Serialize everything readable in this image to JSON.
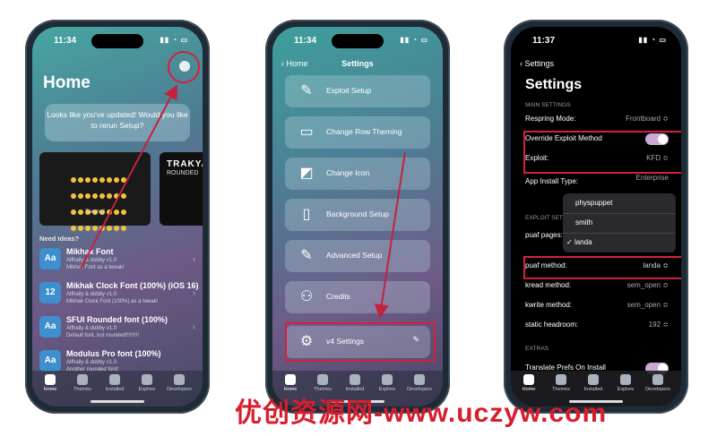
{
  "phones": [
    {
      "time": "11:34",
      "title": "Home",
      "update_prompt": "Looks like you've updated! Would you like to rerun Setup?",
      "cards": [
        {
          "label": "Twemoji"
        },
        {
          "title": "TRAKYA",
          "subtitle": "ROUNDED"
        }
      ],
      "section": "Need Ideas?",
      "items": [
        {
          "icon": "Aa",
          "title": "Mikhak Font",
          "author": "Alfhaily & dobby v1.0",
          "desc": "Mikhak Font as a tweak!"
        },
        {
          "icon": "12",
          "title": "Mikhak Clock Font (100%) (iOS 16)",
          "author": "Alfhaily & dobby v1.0",
          "desc": "Mikhak Clock Font (100%) as a tweak!"
        },
        {
          "icon": "Aa",
          "title": "SFUI Rounded font (100%)",
          "author": "Alfhaily & dobby v1.0",
          "desc": "Default font, but rounded!!!!!!!!!"
        },
        {
          "icon": "Aa",
          "title": "Modulus Pro font (100%)",
          "author": "Alfhaily & dobby v1.0",
          "desc": "Another rounded font!"
        }
      ],
      "tabs": [
        "Home",
        "Themes",
        "Installed",
        "Explore",
        "Developers"
      ]
    },
    {
      "time": "11:34",
      "back": "Home",
      "title": "Settings",
      "buttons": [
        "Exploit Setup",
        "Change Row Theming",
        "Change Icon",
        "Background Setup",
        "Advanced Setup",
        "Credits",
        "v4 Settings"
      ],
      "tabs": [
        "Home",
        "Themes",
        "Installed",
        "Explore",
        "Developers"
      ]
    },
    {
      "time": "11:37",
      "back": "Settings",
      "title": "Settings",
      "sections": {
        "main": "MAIN SETTINGS",
        "exploit": "EXPLOIT SETTINGS",
        "extras": "EXTRAS"
      },
      "rows": {
        "respring_label": "Respring Mode:",
        "respring_value": "Frontboard ≎",
        "override_label": "Override Exploit Method",
        "exploit_label": "Exploit:",
        "exploit_value": "KFD ≎",
        "app_install_label": "App Install Type:",
        "app_install_value": "Enterprise",
        "puaf_pages_label": "puaf pages:",
        "puaf_method_label": "puaf method:",
        "puaf_method_value": "landa ≎",
        "kread_label": "kread method:",
        "kread_value": "sem_open ≎",
        "kwrite_label": "kwrite method:",
        "kwrite_value": "sem_open ≎",
        "headroom_label": "static headroom:",
        "headroom_value": "192 ≎",
        "translate_label": "Translate Prefs On Install"
      },
      "menu": [
        "physpuppet",
        "smith",
        "landa"
      ],
      "menu_checked": "✓",
      "tabs": [
        "Home",
        "Themes",
        "Installed",
        "Explore",
        "Developers"
      ]
    }
  ],
  "watermark": "优创资源网-www.uczyw.com",
  "colors": {
    "highlight": "#d6203a",
    "arrow": "#c4223a"
  }
}
